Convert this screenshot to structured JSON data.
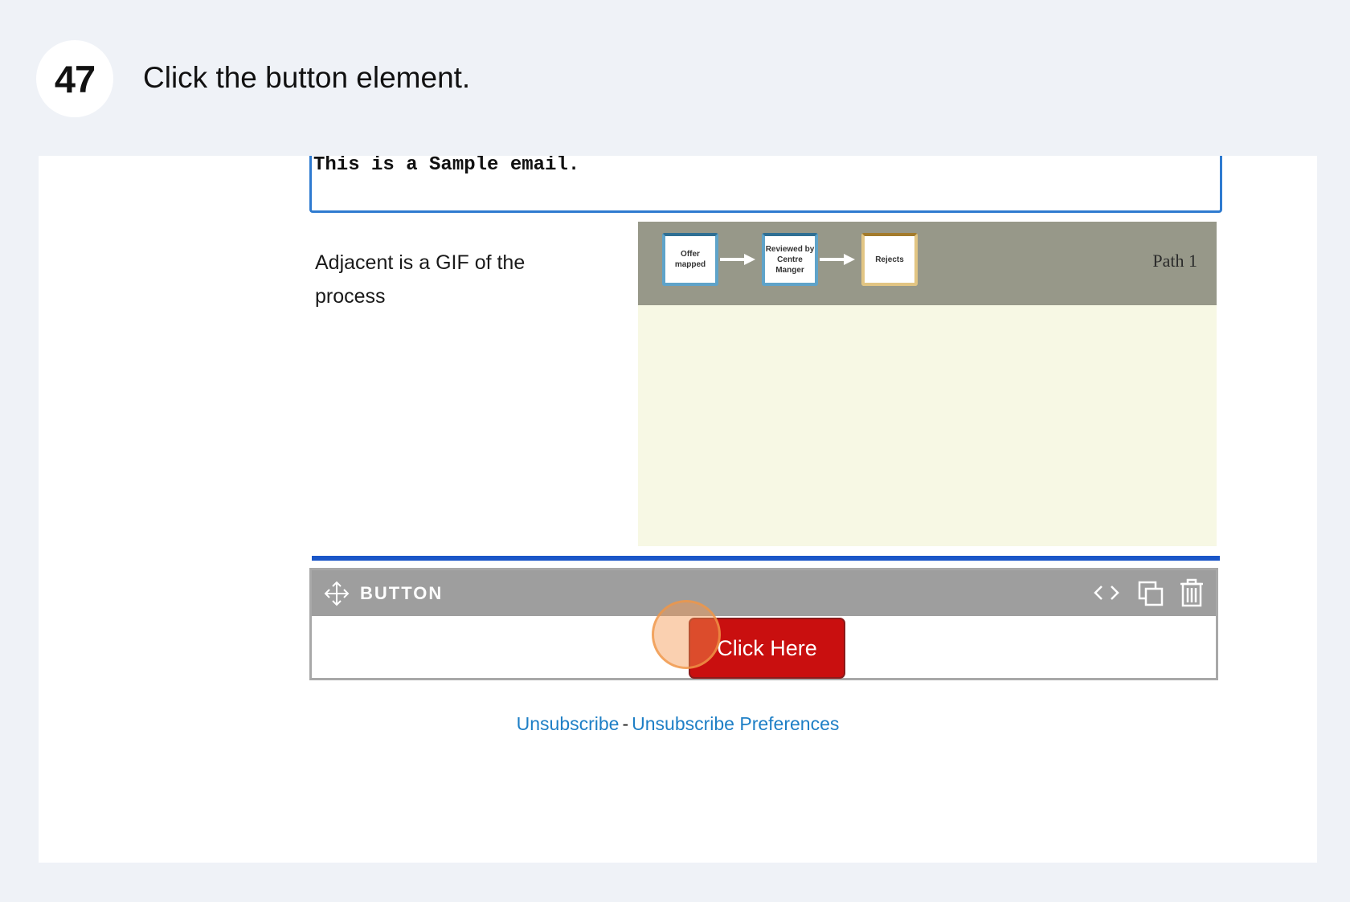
{
  "step": {
    "number": "47",
    "instruction": "Click the button element."
  },
  "email": {
    "sample_text": "This is a Sample email.",
    "adjacent_text": "Adjacent is a GIF of the process",
    "gif": {
      "boxes": [
        "Offer mapped",
        "Reviewed by Centre Manger",
        "Rejects"
      ],
      "path_label": "Path 1"
    },
    "button_block": {
      "toolbar_label": "BUTTON",
      "button_text": "Click Here",
      "button_color": "#c90f0f"
    },
    "footer": {
      "unsubscribe": "Unsubscribe",
      "separator": "-",
      "preferences": "Unsubscribe Preferences"
    }
  },
  "icons": [
    "move-icon",
    "code-icon",
    "duplicate-icon",
    "trash-icon",
    "arrow-right-icon"
  ]
}
